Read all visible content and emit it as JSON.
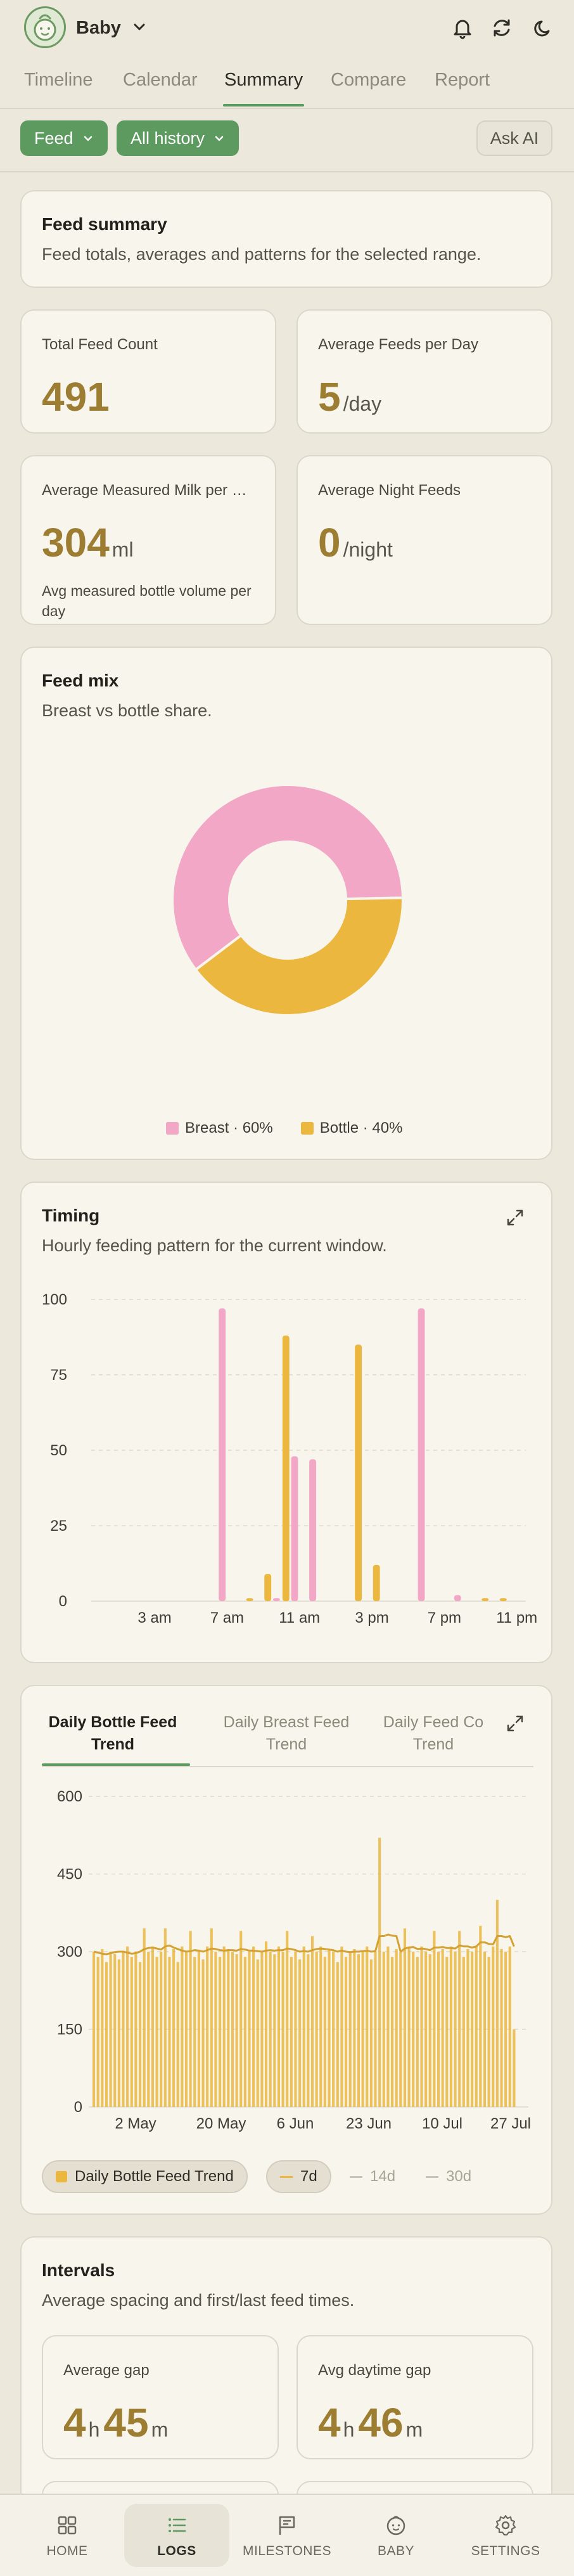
{
  "header": {
    "baby_name": "Baby"
  },
  "tabs": [
    "Timeline",
    "Calendar",
    "Summary",
    "Compare",
    "Report"
  ],
  "active_tab": "Summary",
  "filters": {
    "type_label": "Feed",
    "range_label": "All history",
    "ask_ai_label": "Ask AI"
  },
  "summary": {
    "title": "Feed summary",
    "subtitle": "Feed totals, averages and patterns for the selected range."
  },
  "stats": [
    {
      "label": "Total Feed Count",
      "value": "491",
      "unit": "",
      "note": ""
    },
    {
      "label": "Average Feeds per Day",
      "value": "5",
      "unit": "/day",
      "note": ""
    },
    {
      "label": "Average Measured Milk per Day",
      "value": "304",
      "unit": "ml",
      "note": "Avg measured bottle volume per day"
    },
    {
      "label": "Average Night Feeds",
      "value": "0",
      "unit": "/night",
      "note": ""
    }
  ],
  "feed_mix": {
    "title": "Feed mix",
    "subtitle": "Breast vs bottle share.",
    "legend": [
      {
        "label": "Breast · 60%",
        "color": "#f2a7c7"
      },
      {
        "label": "Bottle · 40%",
        "color": "#ebb73f"
      }
    ]
  },
  "timing": {
    "title": "Timing",
    "subtitle": "Hourly feeding pattern for the current window."
  },
  "trend": {
    "tabs": [
      "Daily Bottle Feed Trend",
      "Daily Breast Feed Trend",
      "Daily Feed Co Trend"
    ],
    "active_tab": 0,
    "legend_label": "Daily Bottle Feed Trend",
    "ranges": [
      "7d",
      "14d",
      "30d"
    ],
    "selected_range": "7d"
  },
  "intervals": {
    "title": "Intervals",
    "subtitle": "Average spacing and first/last feed times.",
    "items": [
      {
        "label": "Average gap",
        "h": "4",
        "m": "45",
        "h_unit": "h",
        "m_unit": "m"
      },
      {
        "label": "Avg daytime gap",
        "h": "4",
        "m": "46",
        "h_unit": "h",
        "m_unit": "m"
      }
    ]
  },
  "bottom_nav": [
    "HOME",
    "LOGS",
    "MILESTONES",
    "BABY",
    "SETTINGS"
  ],
  "active_nav": "LOGS",
  "colors": {
    "breast": "#f2a7c7",
    "bottle": "#ebb73f",
    "accent": "#5c9a60",
    "value": "#9c7d32"
  },
  "chart_data": [
    {
      "type": "pie",
      "categories": [
        "Breast",
        "Bottle"
      ],
      "values": [
        60,
        40
      ],
      "legend": "bottom"
    },
    {
      "type": "bar",
      "categories": [
        "12 am",
        "1 am",
        "2 am",
        "3 am",
        "4 am",
        "5 am",
        "6 am",
        "7 am",
        "8 am",
        "9 am",
        "10 am",
        "11 am",
        "12 pm",
        "1 pm",
        "2 pm",
        "3 pm",
        "4 pm",
        "5 pm",
        "6 pm",
        "7 pm",
        "8 pm",
        "9 pm",
        "10 pm",
        "11 pm"
      ],
      "tick_labels": [
        "3 am",
        "7 am",
        "11 am",
        "3 pm",
        "7 pm",
        "11 pm"
      ],
      "series": [
        {
          "name": "Breast",
          "values": [
            0,
            0,
            0,
            0,
            0,
            0,
            0,
            97,
            0,
            0,
            1,
            48,
            47,
            0,
            0,
            0,
            0,
            0,
            97,
            0,
            2,
            0,
            0,
            0
          ]
        },
        {
          "name": "Bottle",
          "values": [
            0,
            0,
            0,
            0,
            0,
            0,
            0,
            0,
            1,
            9,
            88,
            0,
            0,
            0,
            85,
            12,
            0,
            0,
            0,
            0,
            0,
            1,
            1,
            0
          ]
        }
      ],
      "ylim": [
        0,
        100
      ],
      "yticks": [
        0,
        25,
        50,
        75,
        100
      ],
      "grid": true
    },
    {
      "type": "bar",
      "title": "Daily Bottle Feed Trend",
      "x_start": "2024-04-21",
      "x_tick_labels": [
        "2 May",
        "20 May",
        "6 Jun",
        "23 Jun",
        "10 Jul",
        "27 Jul"
      ],
      "ylim": [
        0,
        600
      ],
      "yticks": [
        0,
        150,
        300,
        450,
        600
      ],
      "series": [
        {
          "name": "Daily Bottle Feed Trend",
          "values": [
            300,
            290,
            305,
            280,
            300,
            295,
            285,
            300,
            310,
            290,
            300,
            280,
            345,
            300,
            310,
            290,
            300,
            345,
            290,
            305,
            280,
            310,
            300,
            340,
            290,
            300,
            285,
            310,
            345,
            300,
            290,
            310,
            305,
            300,
            295,
            340,
            290,
            300,
            310,
            285,
            300,
            320,
            300,
            295,
            310,
            300,
            340,
            290,
            300,
            285,
            310,
            295,
            330,
            300,
            310,
            290,
            305,
            300,
            280,
            310,
            290,
            300,
            305,
            295,
            300,
            310,
            285,
            300,
            520,
            300,
            310,
            290,
            305,
            300,
            345,
            310,
            300,
            290,
            310,
            300,
            295,
            340,
            300,
            305,
            290,
            310,
            300,
            340,
            290,
            305,
            300,
            310,
            350,
            300,
            290,
            310,
            400,
            305,
            300,
            310,
            150
          ]
        },
        {
          "name": "7d average",
          "values": [
            300,
            298,
            296,
            295,
            297,
            299,
            300,
            300,
            298,
            296,
            297,
            300,
            305,
            307,
            308,
            306,
            304,
            310,
            312,
            308,
            305,
            302,
            300,
            301,
            303,
            302,
            300,
            303,
            306,
            305,
            303,
            302,
            303,
            303,
            302,
            305,
            304,
            302,
            302,
            301,
            300,
            302,
            303,
            302,
            303,
            303,
            306,
            305,
            303,
            300,
            301,
            300,
            303,
            305,
            306,
            305,
            304,
            303,
            300,
            302,
            300,
            299,
            300,
            300,
            301,
            302,
            300,
            301,
            330,
            330,
            333,
            331,
            330,
            300,
            306,
            308,
            309,
            305,
            306,
            305,
            303,
            308,
            308,
            309,
            307,
            307,
            306,
            312,
            310,
            310,
            308,
            310,
            318,
            318,
            315,
            314,
            330,
            330,
            328,
            330,
            310
          ]
        }
      ]
    }
  ]
}
